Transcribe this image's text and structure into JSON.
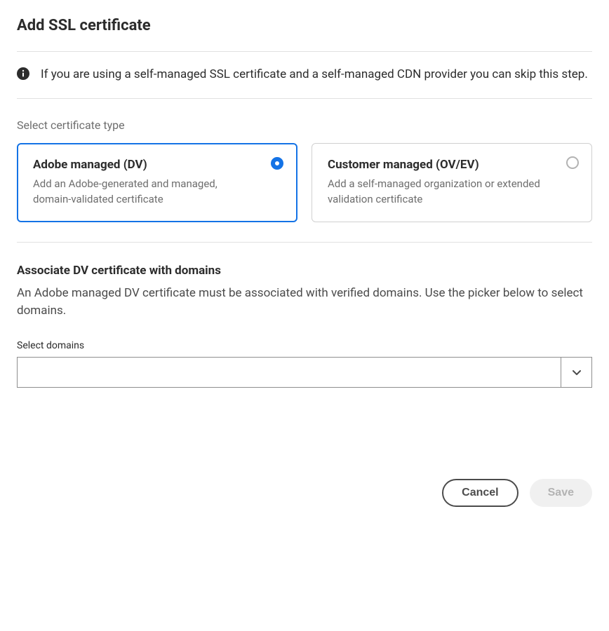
{
  "dialog": {
    "title": "Add SSL certificate"
  },
  "info": {
    "text": "If you are using a self-managed SSL certificate and a self-managed CDN provider you can skip this step."
  },
  "certType": {
    "label": "Select certificate type",
    "options": [
      {
        "title": "Adobe managed (DV)",
        "desc": "Add an Adobe-generated and managed, domain-validated certificate",
        "selected": true
      },
      {
        "title": "Customer managed (OV/EV)",
        "desc": "Add a self-managed organization or extended validation certificate",
        "selected": false
      }
    ]
  },
  "associate": {
    "title": "Associate DV certificate with domains",
    "desc": "An Adobe managed DV certificate must be associated with verified domains. Use the picker below to select domains."
  },
  "domains": {
    "label": "Select domains",
    "value": ""
  },
  "footer": {
    "cancel": "Cancel",
    "save": "Save"
  }
}
